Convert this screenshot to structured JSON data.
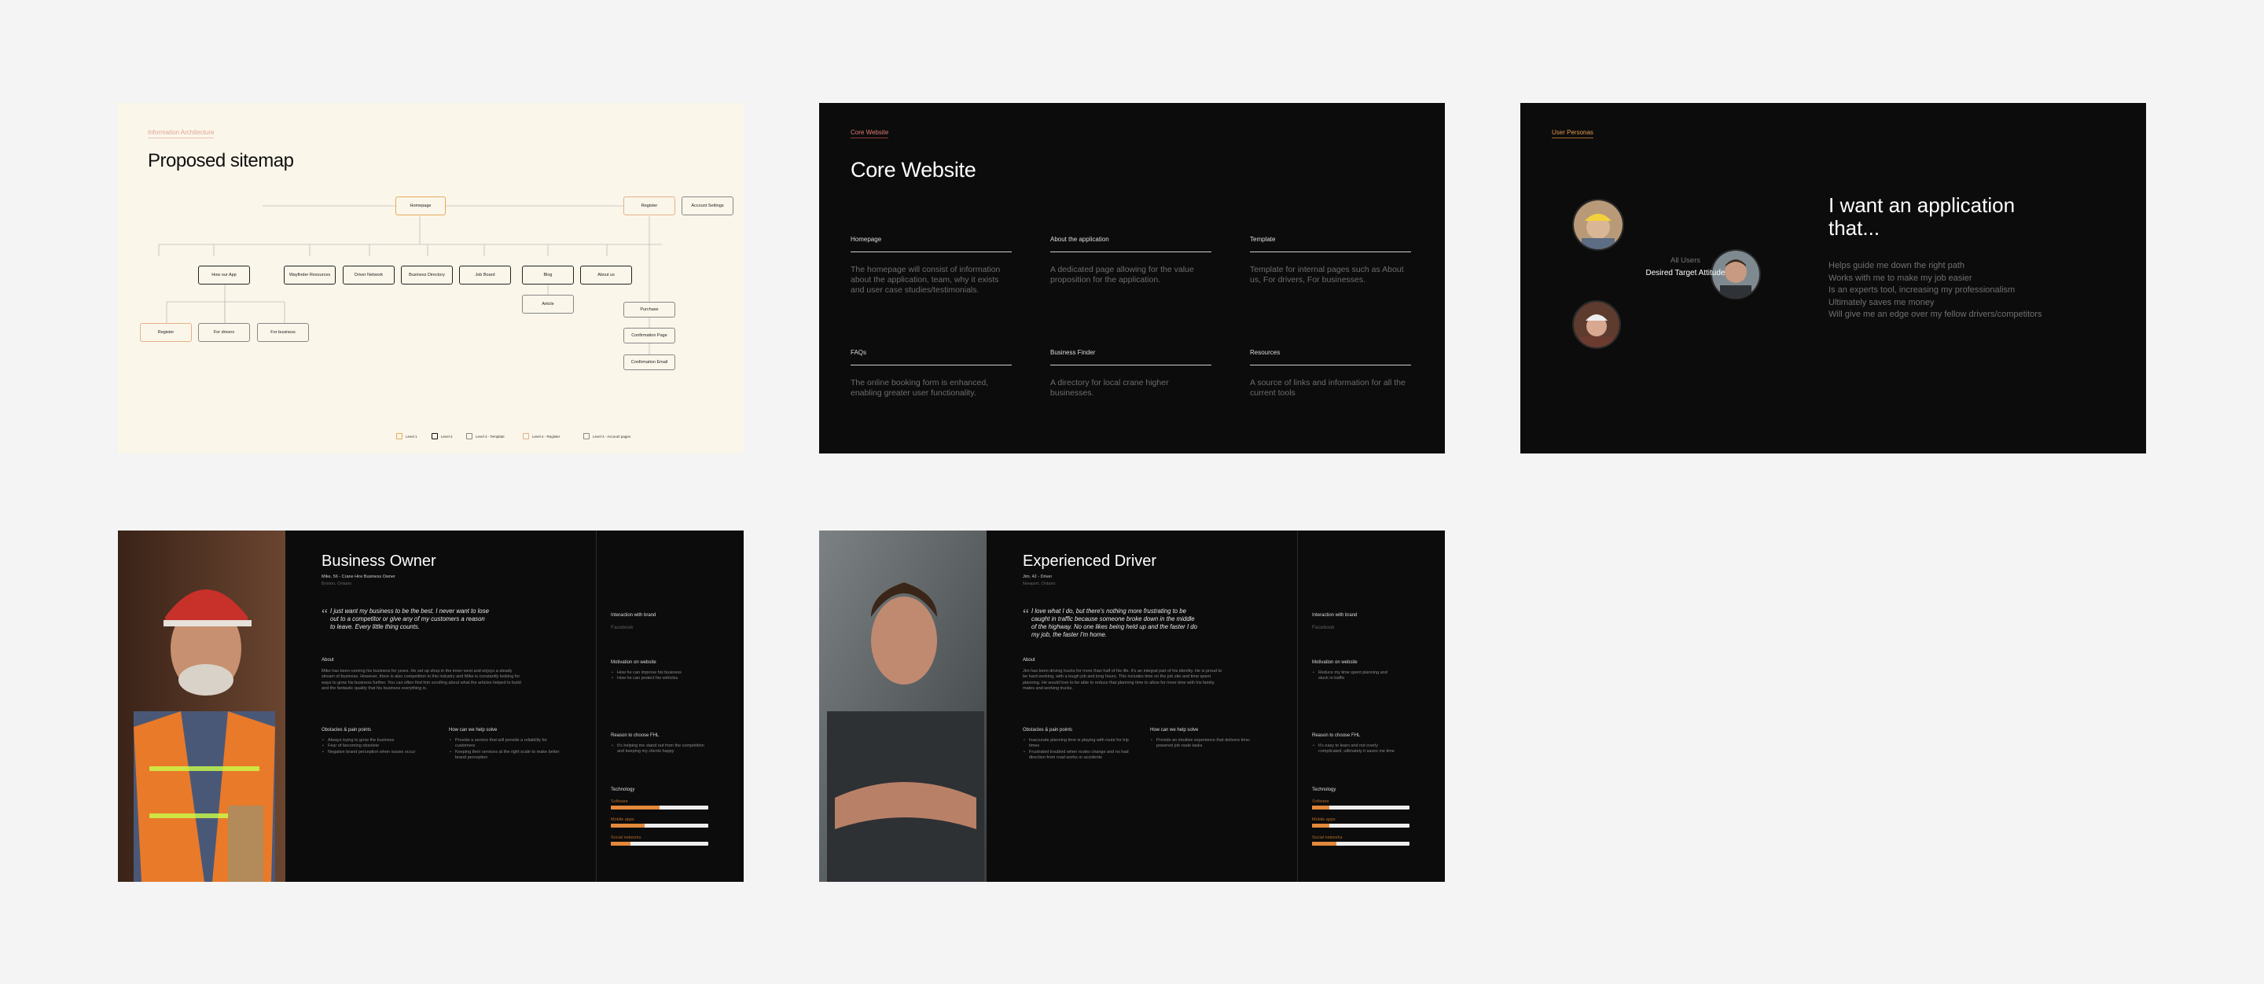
{
  "sitemap": {
    "eyebrow": "Information Architecture",
    "title": "Proposed sitemap",
    "nodes": {
      "homepage": "Homepage",
      "register": "Register",
      "account_settings": "Account Settings",
      "how_app": "How our App",
      "resources": "Wayfinder Resources",
      "driver_network": "Driver Network",
      "business_directory": "Business Directory",
      "job_board": "Job Board",
      "blog": "Blog",
      "about": "About us",
      "article": "Article",
      "register2": "Register",
      "for_drivers": "For drivers",
      "for_business": "For business",
      "purchase": "Purchase",
      "confirmation_page": "Confirmation Page",
      "confirmation_email": "Confirmation Email"
    },
    "legend": [
      "Level 1",
      "Level 2",
      "Level 3 - Template",
      "Level 4 - Register",
      "Level 4 - Account pages"
    ]
  },
  "core": {
    "eyebrow": "Core Website",
    "title": "Core Website",
    "features": [
      {
        "title": "Homepage",
        "desc": "The homepage will consist of information about the application, team, why it exists and user case studies/testimonials."
      },
      {
        "title": "About the application",
        "desc": "A dedicated page allowing for the value proposition for the application."
      },
      {
        "title": "Template",
        "desc": "Template for internal pages such as About us, For drivers, For businesses."
      },
      {
        "title": "FAQs",
        "desc": "The online booking form is enhanced, enabling greater user functionality."
      },
      {
        "title": "Business Finder",
        "desc": "A directory for local crane higher businesses."
      },
      {
        "title": "Resources",
        "desc": "A source of links and information for all the current tools"
      }
    ]
  },
  "personas": {
    "eyebrow": "User Personas",
    "all_users": "All Users",
    "desired": "Desired Target Attitude",
    "headline": "I want an application that...",
    "needs": [
      "Helps guide me down the right path",
      "Works with me to make my job easier",
      "Is an experts tool, increasing my professionalism",
      "Ultimately saves me money",
      "Will give me an edge over my fellow drivers/competitors"
    ]
  },
  "owner": {
    "name": "Business Owner",
    "sub": "Mike, 56 - Crane Hire Business Owner",
    "location": "Brixton, Ontario",
    "quote": "I just want my business to be the best. I never want to lose out to a competitor or give any of my customers a reason to leave. Every little thing counts.",
    "about_label": "About",
    "about": "Mike has been running his business for years. He set up shop in the inner west and enjoys a steady stream of business. However, there is also competition in this industry and Mike is constantly looking for ways to grow his business further. You can often find him scrolling about what the articles helped to build and the fantastic quality that his business everything is.",
    "obstacles_label": "Obstacles & pain points",
    "obstacles": [
      "Always trying to grow the business",
      "Fear of becoming obsolete",
      "Negative brand perception when issues occur"
    ],
    "help_label": "How can we help solve",
    "help": [
      "Provide a service that will provide a reliability for customers",
      "Keeping their services at the right scale to make better brand perception"
    ],
    "interaction_label": "Interaction with brand",
    "interaction": "Facebook",
    "motivation_label": "Motivation on website",
    "motivation": [
      "How he can improve his business",
      "How he can protect his vehicles"
    ],
    "reason_label": "Reason to choose FHL",
    "reason": [
      "It's helping me stand out from the competition and keeping my clients happy"
    ],
    "tech_label": "Technology",
    "tech": [
      {
        "label": "Software",
        "value": 0.5
      },
      {
        "label": "Mobile apps",
        "value": 0.35
      },
      {
        "label": "Social networks",
        "value": 0.2
      }
    ]
  },
  "driver": {
    "name": "Experienced Driver",
    "sub": "Jim, 42 - Driver",
    "location": "Newport, Ontario",
    "quote": "I love what I do, but there's nothing more frustrating to be caught in traffic because someone broke down in the middle of the highway. No one likes being held up and the faster I do my job, the faster I'm home.",
    "about_label": "About",
    "about": "Jim has been driving trucks for more than half of his life. It's an integral part of his identity. He is proud to be hard working, with a tough job and long hours. This includes time on the job site and time spent planning. He would love to be able to reduce that planning time to allow for more time with his family, mates and working trucks.",
    "obstacles_label": "Obstacles & pain points",
    "obstacles": [
      "Inaccurate planning time is playing with route for trip times",
      "Frustrated troubled when routes change and no had direction from road works or accidents"
    ],
    "help_label": "How can we help solve",
    "help": [
      "Provide an intuitive experience that delivers time-powered job route tasks"
    ],
    "interaction_label": "Interaction with brand",
    "interaction": "Facebook",
    "motivation_label": "Motivation on website",
    "motivation": [
      "Reduce my time spent planning and stuck in traffic"
    ],
    "reason_label": "Reason to choose FHL",
    "reason": [
      "It's easy to learn and not overly complicated, ultimately it saves me time"
    ],
    "tech_label": "Technology",
    "tech": [
      {
        "label": "Software",
        "value": 0.18
      },
      {
        "label": "Mobile apps",
        "value": 0.18
      },
      {
        "label": "Social networks",
        "value": 0.25
      }
    ]
  }
}
